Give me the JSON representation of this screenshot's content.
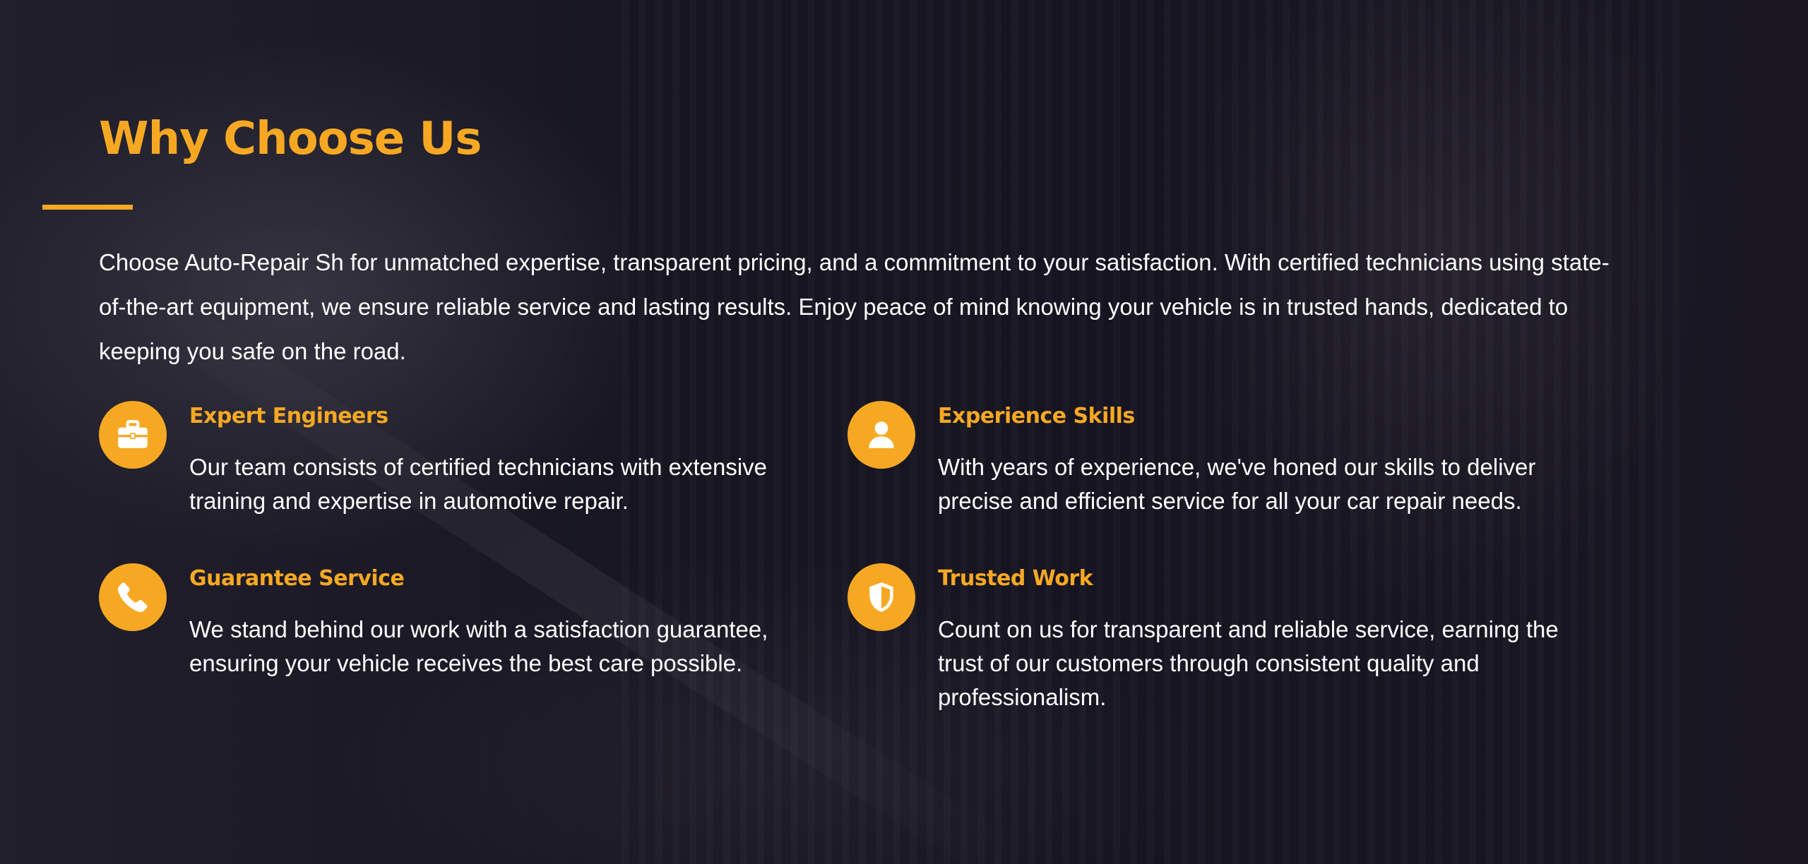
{
  "section": {
    "title": "Why Choose Us",
    "intro": "Choose Auto-Repair Sh for unmatched expertise, transparent pricing, and a commitment to your satisfaction. With certified technicians using state-of-the-art equipment, we ensure reliable service and lasting results. Enjoy peace of mind knowing your vehicle is in trusted hands, dedicated to keeping you safe on the road."
  },
  "features": [
    {
      "icon": "briefcase-icon",
      "title": "Expert Engineers",
      "description": "Our team consists of certified technicians with extensive training and expertise in automotive repair."
    },
    {
      "icon": "user-icon",
      "title": "Experience Skills",
      "description": "With years of experience, we've honed our skills to deliver precise and efficient service for all your car repair needs."
    },
    {
      "icon": "phone-icon",
      "title": "Guarantee Service",
      "description": "We stand behind our work with a satisfaction guarantee, ensuring your vehicle receives the best care possible."
    },
    {
      "icon": "shield-icon",
      "title": "Trusted Work",
      "description": "Count on us for transparent and reliable service, earning the trust of our customers through consistent quality and professionalism."
    }
  ],
  "colors": {
    "accent": "#f7a823",
    "text": "#ffffff",
    "background": "#16151f"
  }
}
